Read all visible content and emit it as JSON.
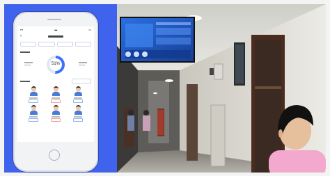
{
  "phone_screen": {
    "ring_percent": "51%",
    "ring_value": 0.51
  },
  "colors": {
    "left_panel": "#3f63ec",
    "ring_accent": "#3a72ff",
    "tv_screen": "#1f5cc8",
    "shirt": "#f3a8cd"
  },
  "icons": [
    "back-arrow-icon",
    "person-avatar-icon",
    "home-button-icon"
  ]
}
